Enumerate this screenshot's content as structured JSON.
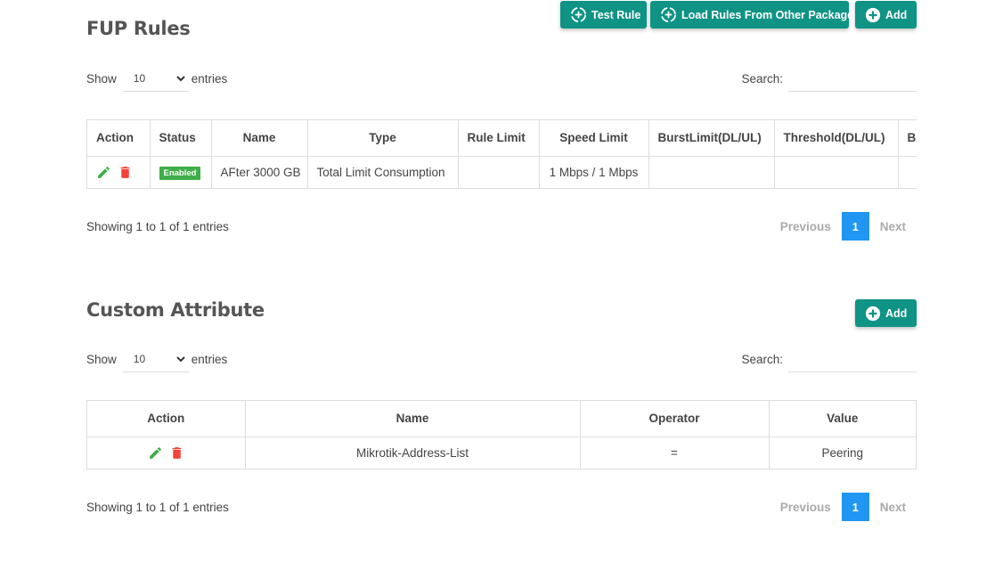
{
  "fup": {
    "title": "FUP Rules",
    "buttons": {
      "test_rule": "Test Rule",
      "load_rules": "Load Rules From Other Package",
      "add": "Add"
    },
    "show_label": "Show",
    "entries_value": "10",
    "entries_label": "entries",
    "search_label": "Search:",
    "search_value": "",
    "columns": [
      "Action",
      "Status",
      "Name",
      "Type",
      "Rule Limit",
      "Speed Limit",
      "BurstLimit(DL/UL)",
      "Threshold(DL/UL)",
      "Bu"
    ],
    "rows": [
      {
        "status": "Enabled",
        "name": "AFter 3000 GB",
        "type": "Total Limit Consumption",
        "rule_limit": "",
        "speed_limit": "1 Mbps / 1 Mbps",
        "burst_limit": "",
        "threshold": "",
        "extra": ""
      }
    ],
    "info": "Showing 1 to 1 of 1 entries",
    "pager": {
      "previous": "Previous",
      "page": "1",
      "next": "Next"
    }
  },
  "custom": {
    "title": "Custom Attribute",
    "buttons": {
      "add": "Add"
    },
    "show_label": "Show",
    "entries_value": "10",
    "entries_label": "entries",
    "search_label": "Search:",
    "search_value": "",
    "columns": [
      "Action",
      "Name",
      "Operator",
      "Value"
    ],
    "rows": [
      {
        "name": "Mikrotik-Address-List",
        "operator": "=",
        "value": "Peering"
      }
    ],
    "info": "Showing 1 to 1 of 1 entries",
    "pager": {
      "previous": "Previous",
      "page": "1",
      "next": "Next"
    }
  },
  "colors": {
    "primary": "#0e9384",
    "enabled": "#3fae49",
    "edit": "#3fae49",
    "delete": "#f44336",
    "page_active": "#2196f3"
  },
  "icons": {
    "test": "refresh-plus-icon",
    "load": "refresh-plus-icon",
    "add": "plus-circle-icon",
    "edit": "pencil-icon",
    "delete": "trash-icon",
    "select": "chevron-down-icon"
  }
}
